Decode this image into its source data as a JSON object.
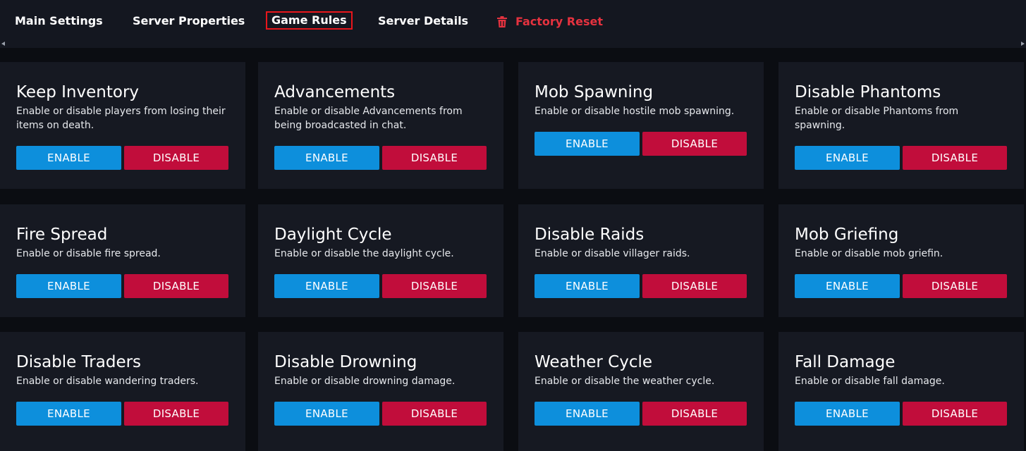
{
  "tabs": [
    {
      "label": "Main Settings"
    },
    {
      "label": "Server Properties"
    },
    {
      "label": "Game Rules"
    },
    {
      "label": "Server Details"
    },
    {
      "label": "Factory Reset"
    }
  ],
  "active_tab": "Game Rules",
  "colors": {
    "enable": "#0d8fdc",
    "disable": "#c10d3b",
    "danger": "#e5323f",
    "active_outline": "#e8161b"
  },
  "rules": [
    {
      "title": "Keep Inventory",
      "desc": "Enable or disable players from losing their items on death.",
      "enable": "ENABLE",
      "disable": "DISABLE"
    },
    {
      "title": "Advancements",
      "desc": "Enable or disable Advancements from being broadcasted in chat.",
      "enable": "ENABLE",
      "disable": "DISABLE"
    },
    {
      "title": "Mob Spawning",
      "desc": "Enable or disable hostile mob spawning.",
      "enable": "ENABLE",
      "disable": "DISABLE"
    },
    {
      "title": "Disable Phantoms",
      "desc": "Enable or disable Phantoms from spawning.",
      "enable": "ENABLE",
      "disable": "DISABLE"
    },
    {
      "title": "Fire Spread",
      "desc": "Enable or disable fire spread.",
      "enable": "ENABLE",
      "disable": "DISABLE"
    },
    {
      "title": "Daylight Cycle",
      "desc": "Enable or disable the daylight cycle.",
      "enable": "ENABLE",
      "disable": "DISABLE"
    },
    {
      "title": "Disable Raids",
      "desc": "Enable or disable villager raids.",
      "enable": "ENABLE",
      "disable": "DISABLE"
    },
    {
      "title": "Mob Griefing",
      "desc": "Enable or disable mob griefin.",
      "enable": "ENABLE",
      "disable": "DISABLE"
    },
    {
      "title": "Disable Traders",
      "desc": "Enable or disable wandering traders.",
      "enable": "ENABLE",
      "disable": "DISABLE"
    },
    {
      "title": "Disable Drowning",
      "desc": "Enable or disable drowning damage.",
      "enable": "ENABLE",
      "disable": "DISABLE"
    },
    {
      "title": "Weather Cycle",
      "desc": "Enable or disable the weather cycle.",
      "enable": "ENABLE",
      "disable": "DISABLE"
    },
    {
      "title": "Fall Damage",
      "desc": "Enable or disable fall damage.",
      "enable": "ENABLE",
      "disable": "DISABLE"
    }
  ]
}
